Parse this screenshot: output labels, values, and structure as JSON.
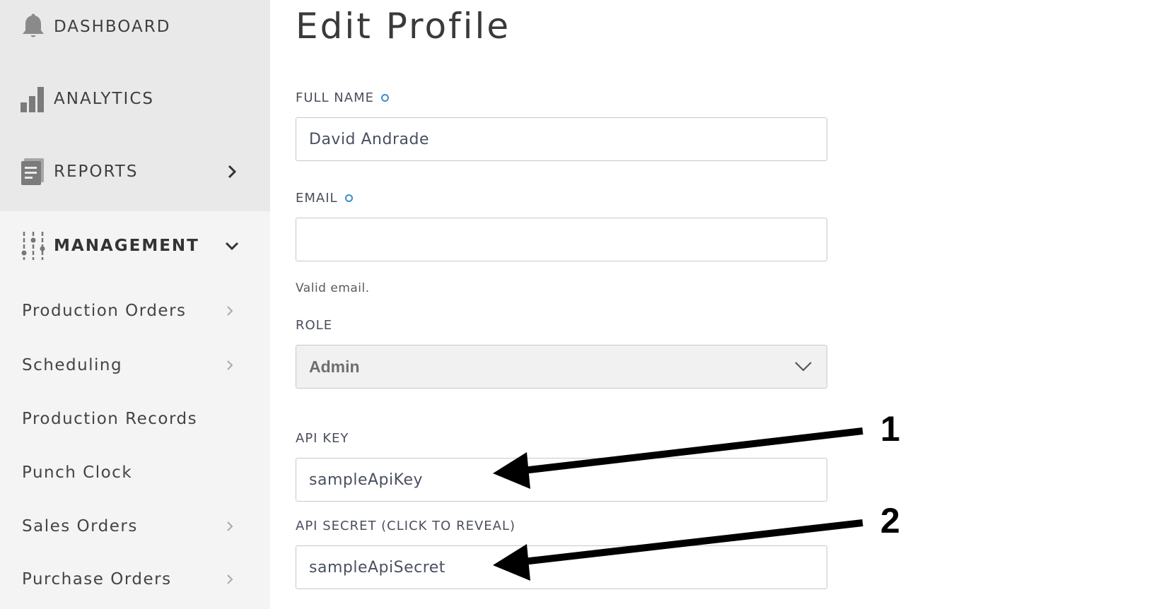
{
  "sidebar": {
    "items": [
      {
        "label": "DASHBOARD",
        "icon": "bell-icon"
      },
      {
        "label": "ANALYTICS",
        "icon": "bar-chart-icon"
      },
      {
        "label": "REPORTS",
        "icon": "document-icon"
      },
      {
        "label": "MANAGEMENT",
        "icon": "sliders-icon"
      }
    ],
    "management_items": [
      {
        "label": "Production Orders"
      },
      {
        "label": "Scheduling"
      },
      {
        "label": "Production Records"
      },
      {
        "label": "Punch Clock"
      },
      {
        "label": "Sales Orders"
      },
      {
        "label": "Purchase Orders"
      }
    ]
  },
  "main": {
    "title": "Edit Profile",
    "full_name": {
      "label": "FULL NAME",
      "value": "David Andrade"
    },
    "email": {
      "label": "EMAIL",
      "value": "",
      "hint": "Valid email."
    },
    "role": {
      "label": "ROLE",
      "value": "Admin"
    },
    "api_key": {
      "label": "API KEY",
      "value": "sampleApiKey"
    },
    "api_secret": {
      "label": "API SECRET (CLICK TO REVEAL)",
      "value": "sampleApiSecret"
    }
  },
  "annotations": {
    "marker_1": "1",
    "marker_2": "2"
  },
  "colors": {
    "required_dot": "#3a8fd0",
    "sidebar_top_bg": "#e9e9e9",
    "sidebar_bg": "#f4f4f4",
    "select_bg": "#f1f1f1"
  }
}
